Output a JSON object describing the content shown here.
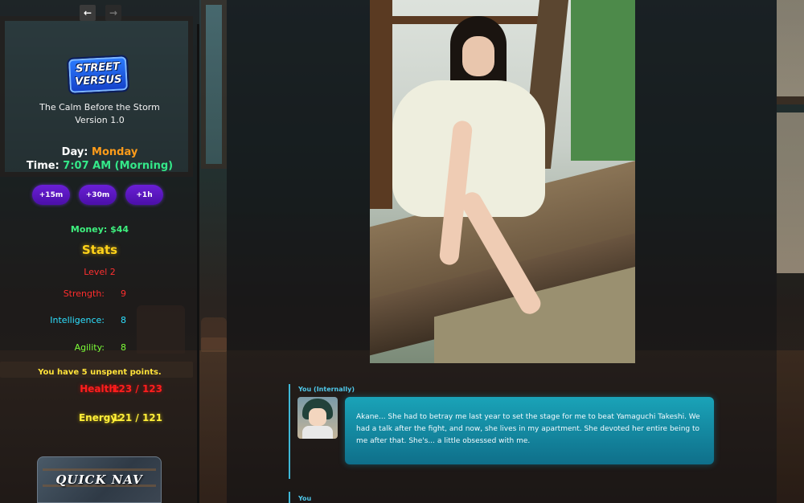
{
  "sidebar": {
    "back_arrow": "←",
    "forward_arrow": "→",
    "logo_lines": [
      "STREET",
      "VERSUS"
    ],
    "title": "The Calm Before the Storm",
    "version": "Version 1.0",
    "day_label": "Day:",
    "day_value": "Monday",
    "time_label": "Time:",
    "time_value": "7:07 AM (Morning)",
    "time_buttons": [
      "+15m",
      "+30m",
      "+1h"
    ],
    "money": "Money: $44",
    "stats_title": "Stats",
    "level": "Level 2",
    "stats": [
      {
        "label": "Strength:",
        "value": "9"
      },
      {
        "label": "Intelligence:",
        "value": "8"
      },
      {
        "label": "Agility:",
        "value": "8"
      }
    ],
    "unspent": "You have 5 unspent points.",
    "health_label": "Health:",
    "health_value": "123 / 123",
    "energy_label": "Energy:",
    "energy_value": "121 / 121",
    "quick_nav": "QUICK NAV"
  },
  "dialogue": {
    "speaker": "You (Internally)",
    "text": "Akane... She had to betray me last year to set the stage for me to beat Yamaguchi Takeshi. We had a talk after the fight, and now, she lives in my apartment. She devoted her entire being to me after that. She's... a little obsessed with me.",
    "next_speaker": "You"
  },
  "colors": {
    "accent_purple": "#5a14c0",
    "dialogue_teal": "#1aa3b8",
    "health_red": "#ff1e1e",
    "energy_yellow": "#ffef3a",
    "money_green": "#3ef07e"
  }
}
